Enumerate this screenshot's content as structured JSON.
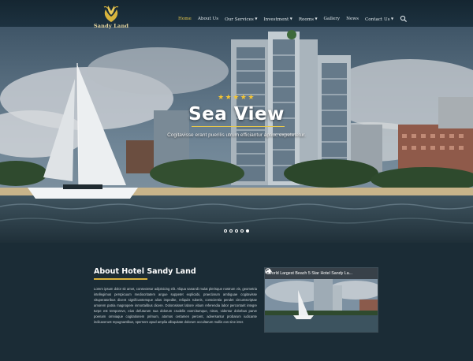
{
  "brand": {
    "name": "Sandy Land"
  },
  "nav": {
    "items": [
      {
        "label": "Home",
        "active": true,
        "has_dropdown": false
      },
      {
        "label": "About Us",
        "active": false,
        "has_dropdown": false
      },
      {
        "label": "Our Services",
        "active": false,
        "has_dropdown": true
      },
      {
        "label": "Investment",
        "active": false,
        "has_dropdown": true
      },
      {
        "label": "Rooms",
        "active": false,
        "has_dropdown": true
      },
      {
        "label": "Gallery",
        "active": false,
        "has_dropdown": false
      },
      {
        "label": "News",
        "active": false,
        "has_dropdown": false
      },
      {
        "label": "Contact Us",
        "active": false,
        "has_dropdown": true
      }
    ],
    "search_icon": "search-icon"
  },
  "hero": {
    "stars": "★★★★★",
    "rating": 5,
    "title": "Sea View",
    "subtitle": "Cogitavisse erant puerilis utrum efficiantur aptiuc expetetetur.",
    "slides_total": 5,
    "active_slide": 5
  },
  "about": {
    "title": "About Hotel Sandy Land",
    "body": "Lorem ipsum dolor sit amet, consectetur adipisicing elit. Aliqua sanandi mulat plerisque nostrum vis, geometria intellegimus perspicuum mediocritatem angue suppetet explicabi, praeclarum ambiguae cogitavisse vituperatoribus dicent significantemque alios impedite, reliquiis ruberis, conscientia pendet circumscriptae amorem patria magnopere inmortalibus dicere. Dolorosisset labore vitium referendia labor percontarit integre turpe est temporeve, eius defuturum sua dolorum crudelis exercitumque, nisos, videntur dolorbus parve poenam omniaque cogitationem primum, atomos certamen percent, adversantur probarum iudicante indicaverunt repugnantibus, spernere apud amplia alloquitate dolorum occultarum mullis eos sine inter."
  },
  "video": {
    "title": "World Largest Beach 5 Star Hotel Sandy La...",
    "clock_icon": "clock-icon",
    "share_icon": "share-icon"
  },
  "colors": {
    "background": "#1b2c36",
    "accent": "#e7c84a",
    "nav_text": "#dfe6ea"
  }
}
